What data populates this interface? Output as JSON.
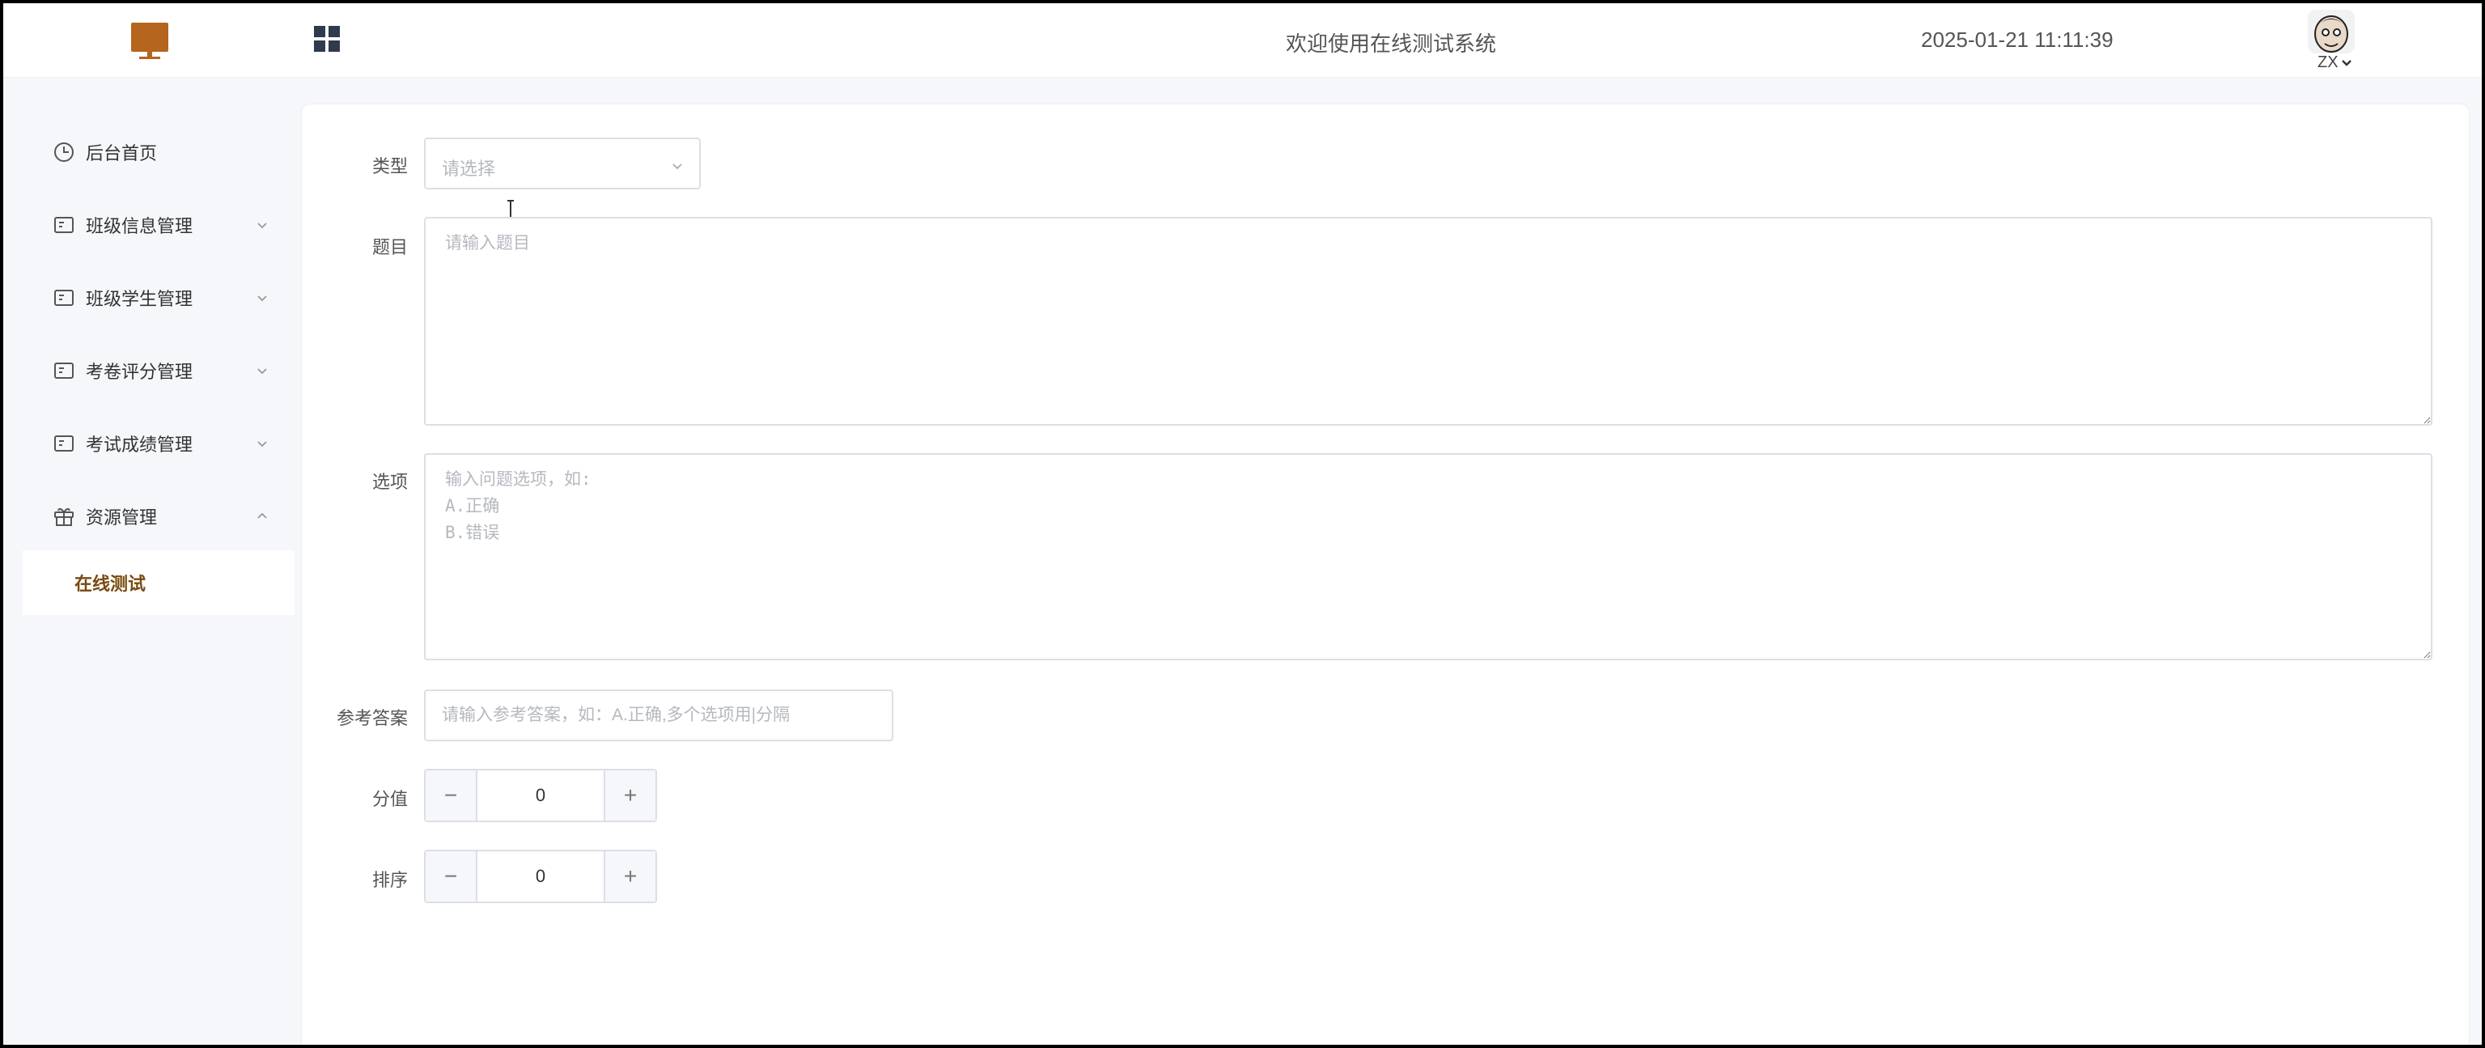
{
  "header": {
    "welcome": "欢迎使用在线测试系统",
    "datetime": "2025-01-21 11:11:39",
    "user": "ZX",
    "logo_icon": "monitor-icon",
    "menu_icon": "grid-icon"
  },
  "sidebar": {
    "items": [
      {
        "label": "后台首页",
        "icon": "clock-icon"
      },
      {
        "label": "班级信息管理",
        "icon": "card-icon"
      },
      {
        "label": "班级学生管理",
        "icon": "card-icon"
      },
      {
        "label": "考卷评分管理",
        "icon": "card-icon"
      },
      {
        "label": "考试成绩管理",
        "icon": "card-icon"
      },
      {
        "label": "资源管理",
        "icon": "gift-icon"
      }
    ],
    "active_sub": "在线测试"
  },
  "form": {
    "type_label": "类型",
    "type_placeholder": "请选择",
    "question_label": "题目",
    "question_placeholder": "请输入题目",
    "options_label": "选项",
    "options_placeholder": "输入问题选项，如:\nA.正确\nB.错误",
    "answer_label": "参考答案",
    "answer_placeholder": "请输入参考答案，如：A.正确,多个选项用|分隔",
    "score_label": "分值",
    "score_value": "0",
    "order_label": "排序",
    "order_value": "0",
    "minus_symbol": "−",
    "plus_symbol": "+"
  },
  "colors": {
    "accent": "#7a4a0f",
    "logo": "#b5651d"
  }
}
